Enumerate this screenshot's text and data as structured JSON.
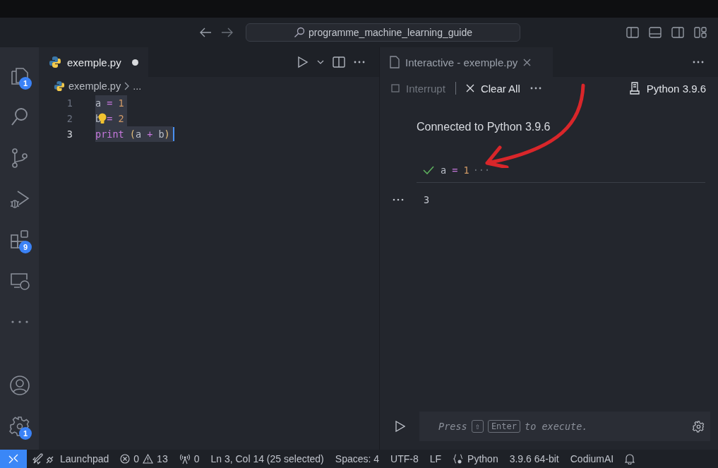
{
  "title_bar": {
    "search": "programme_machine_learning_guide"
  },
  "activity_bar": {
    "top": [
      {
        "kind": "files",
        "badge": "1",
        "selected": false
      },
      {
        "kind": "search",
        "selected": false
      },
      {
        "kind": "source-control",
        "selected": false
      },
      {
        "kind": "run-debug",
        "selected": false
      },
      {
        "kind": "extensions",
        "badge": "9",
        "selected": false
      },
      {
        "kind": "remote",
        "selected": false
      },
      {
        "kind": "more",
        "selected": false
      }
    ],
    "bottom": [
      {
        "kind": "account"
      },
      {
        "kind": "settings",
        "badge": "1"
      }
    ]
  },
  "editor": {
    "tab": {
      "label": "exemple.py",
      "modified": true
    },
    "breadcrumb": [
      "exemple.py",
      "..."
    ],
    "lines": [
      {
        "number": "1",
        "current": false,
        "selected": true,
        "tokens": [
          {
            "text": "a",
            "kind": "ident"
          },
          {
            "text": " = ",
            "kind": "op"
          },
          {
            "text": "1",
            "kind": "num"
          }
        ]
      },
      {
        "number": "2",
        "current": false,
        "selected": true,
        "lightbulb": true,
        "tokens": [
          {
            "text": "b",
            "kind": "ident"
          },
          {
            "text": " = ",
            "kind": "op"
          },
          {
            "text": "2",
            "kind": "num"
          }
        ]
      },
      {
        "number": "3",
        "current": true,
        "selected": true,
        "cursor": true,
        "tokens": [
          {
            "text": "print ",
            "kind": "func"
          },
          {
            "text": "(",
            "kind": "paren"
          },
          {
            "text": "a",
            "kind": "ident"
          },
          {
            "text": " + ",
            "kind": "op"
          },
          {
            "text": "b",
            "kind": "ident"
          },
          {
            "text": ")",
            "kind": "paren"
          }
        ]
      }
    ]
  },
  "interactive": {
    "tab": {
      "label": "Interactive - exemple.py"
    },
    "toolbar": {
      "interrupt": {
        "label": "Interrupt",
        "disabled": true
      },
      "clear_all": {
        "label": "Clear All",
        "disabled": false
      },
      "kernel": "Python 3.9.6"
    },
    "message": "Connected to Python 3.9.6",
    "cell": {
      "succeeded": true,
      "tokens": [
        {
          "text": "a",
          "kind": "ident"
        },
        {
          "text": " = ",
          "kind": "op"
        },
        {
          "text": "1",
          "kind": "num"
        }
      ],
      "collapsed": "···",
      "output": "3"
    },
    "input": {
      "before": "Press",
      "keys": [
        "⇧",
        "Enter"
      ],
      "after": "to execute."
    }
  },
  "status_bar": [
    {
      "kind": "remote"
    },
    {
      "kind": "launchpad",
      "text": "Launchpad"
    },
    {
      "kind": "problems",
      "errors": "0",
      "warnings": "13"
    },
    {
      "kind": "ports",
      "text": "0"
    },
    {
      "kind": "text",
      "text": "Ln 3, Col 14 (25 selected)"
    },
    {
      "kind": "text",
      "text": "Spaces: 4"
    },
    {
      "kind": "text",
      "text": "UTF-8"
    },
    {
      "kind": "text",
      "text": "LF"
    },
    {
      "kind": "language",
      "text": "Python"
    },
    {
      "kind": "text",
      "text": "3.9.6 64-bit"
    },
    {
      "kind": "text",
      "text": "CodiumAI"
    },
    {
      "kind": "bell"
    }
  ]
}
